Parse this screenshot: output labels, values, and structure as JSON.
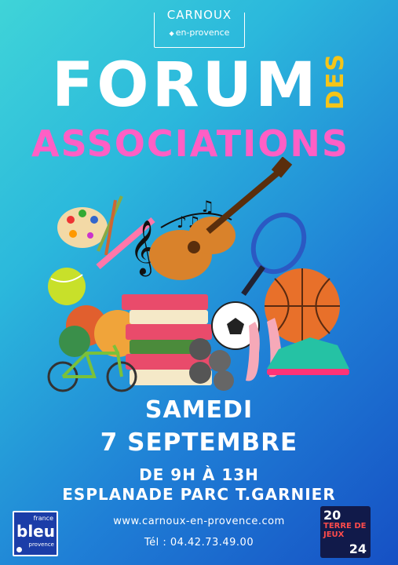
{
  "logo": {
    "name": "CARNOUX",
    "sub": "en-provence"
  },
  "title": {
    "forum": "FORUM",
    "des": "DES",
    "associations": "ASSOCIATIONS"
  },
  "event": {
    "day": "SAMEDI",
    "date": "7 SEPTEMBRE",
    "time": "DE 9H À 13H",
    "place": "ESPLANADE PARC T.GARNIER"
  },
  "contact": {
    "website": "www.carnoux-en-provence.com",
    "phone": "Tél : 04.42.73.49.00"
  },
  "sponsors": {
    "france_bleu": {
      "line1": "france",
      "line2": "bleu",
      "line3": "provence"
    },
    "terre_de_jeux": {
      "year_top": "20",
      "label": "TERRE DE JEUX",
      "year_bottom": "24"
    }
  },
  "colors": {
    "background_start": "#3fd4d8",
    "background_end": "#1650c4",
    "forum": "#ffffff",
    "des": "#f5c518",
    "associations": "#ff5fc5"
  },
  "illustration_items": [
    "palette-icon",
    "paintbrush-icon",
    "treble-clef-icon",
    "music-notes-icon",
    "guitar-icon",
    "tennis-racket-icon",
    "tennis-ball-icon",
    "yarn-balls-icon",
    "books-icon",
    "soccer-ball-icon",
    "basketball-icon",
    "petanque-balls-icon",
    "ballet-shoes-icon",
    "sneaker-icon",
    "bicycle-icon"
  ]
}
